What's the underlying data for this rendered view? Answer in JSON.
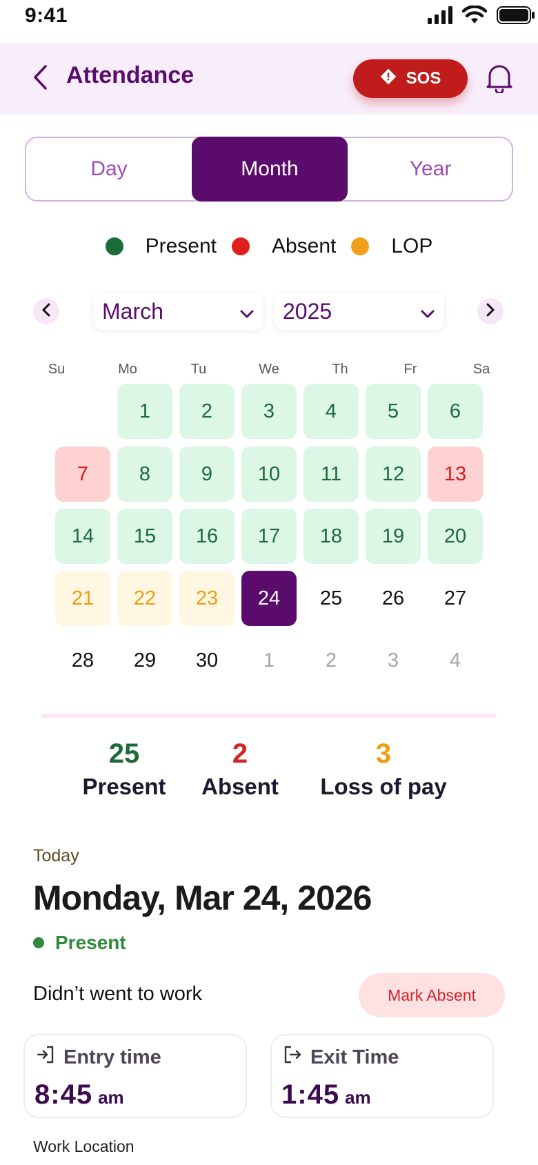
{
  "status_bar": {
    "time": "9:41"
  },
  "header": {
    "title": "Attendance",
    "sos_label": "SOS"
  },
  "tabs": [
    {
      "label": "Day"
    },
    {
      "label": "Month"
    },
    {
      "label": "Year"
    }
  ],
  "legend": [
    {
      "label": "Present",
      "color": "#1c6b3a"
    },
    {
      "label": "Absent",
      "color": "#e01e1e"
    },
    {
      "label": "LOP",
      "color": "#f2a01a"
    }
  ],
  "selectors": {
    "month": "March",
    "year": "2025"
  },
  "calendar": {
    "weekdays": [
      "Su",
      "Mo",
      "Tu",
      "We",
      "Th",
      "Fr",
      "Sa"
    ],
    "weeks": [
      [
        {
          "day": "",
          "status": "empty"
        },
        {
          "day": "1",
          "status": "present"
        },
        {
          "day": "2",
          "status": "present"
        },
        {
          "day": "3",
          "status": "present"
        },
        {
          "day": "4",
          "status": "present"
        },
        {
          "day": "5",
          "status": "present"
        },
        {
          "day": "6",
          "status": "present"
        }
      ],
      [
        {
          "day": "7",
          "status": "absent"
        },
        {
          "day": "8",
          "status": "present"
        },
        {
          "day": "9",
          "status": "present"
        },
        {
          "day": "10",
          "status": "present"
        },
        {
          "day": "11",
          "status": "present"
        },
        {
          "day": "12",
          "status": "present"
        },
        {
          "day": "13",
          "status": "absent"
        }
      ],
      [
        {
          "day": "14",
          "status": "present"
        },
        {
          "day": "15",
          "status": "present"
        },
        {
          "day": "16",
          "status": "present"
        },
        {
          "day": "17",
          "status": "present"
        },
        {
          "day": "18",
          "status": "present"
        },
        {
          "day": "19",
          "status": "present"
        },
        {
          "day": "20",
          "status": "present"
        }
      ],
      [
        {
          "day": "21",
          "status": "lop"
        },
        {
          "day": "22",
          "status": "lop"
        },
        {
          "day": "23",
          "status": "lop"
        },
        {
          "day": "24",
          "status": "today"
        },
        {
          "day": "25",
          "status": "normal"
        },
        {
          "day": "26",
          "status": "normal"
        },
        {
          "day": "27",
          "status": "normal"
        }
      ],
      [
        {
          "day": "28",
          "status": "normal"
        },
        {
          "day": "29",
          "status": "normal"
        },
        {
          "day": "30",
          "status": "normal"
        },
        {
          "day": "1",
          "status": "muted"
        },
        {
          "day": "2",
          "status": "muted"
        },
        {
          "day": "3",
          "status": "muted"
        },
        {
          "day": "4",
          "status": "muted"
        }
      ]
    ]
  },
  "summary": [
    {
      "value": "25",
      "label": "Present",
      "color": "#1c6b3a"
    },
    {
      "value": "2",
      "label": "Absent",
      "color": "#d32525"
    },
    {
      "value": "3",
      "label": "Loss of pay",
      "color": "#ef9d12"
    }
  ],
  "today": {
    "label": "Today",
    "date": "Monday, Mar 24, 2026",
    "status": "Present",
    "not_work_text": "Didn’t went to work",
    "mark_absent_label": "Mark Absent"
  },
  "times": {
    "entry": {
      "label": "Entry time",
      "value": "8:45",
      "ampm": "am"
    },
    "exit": {
      "label": "Exit Time",
      "value": "1:45",
      "ampm": "am"
    }
  },
  "work_location_label": "Work Location"
}
